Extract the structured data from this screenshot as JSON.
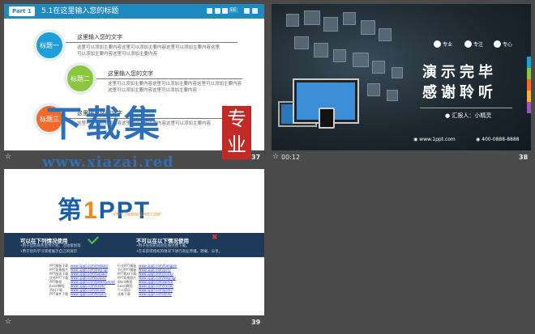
{
  "slides": [
    {
      "number": "37",
      "badge": "Part 1",
      "title": "5.1在这里输入您的标题",
      "nav_label": "EE",
      "topics": [
        {
          "label": "标题一",
          "heading": "这里输入您的文字",
          "color": "#1e9fd8",
          "body": "这里可以添加主要内容这里可以添加主要内容这里可以添加主要内容这里可以添加主要内容这里可以添加主要内容"
        },
        {
          "label": "标题二",
          "heading": "这里输入您的文字",
          "color": "#8cc63f",
          "body": "这里可以添加主要内容这里可以添加主要内容这里可以添加主要内容这里可以添加主要内容这里可以添加主要内容"
        },
        {
          "label": "标题三",
          "heading": "这里输入您的文字",
          "color": "#f26b2b",
          "body": "这里可以添加主要内容这里可以添加主要内容这里可以添加主要内容"
        }
      ]
    },
    {
      "number": "38",
      "time": "00:12",
      "features": [
        "专业",
        "专注",
        "专心"
      ],
      "line1": "演示完毕",
      "line2": "感谢聆听",
      "reporter": "汇报人：小精灵",
      "website": "www.1ppt.com",
      "phone": "400-0888-8888",
      "accent_colors": [
        "#1e9fd8",
        "#8cc63f",
        "#f26b2b",
        "#f5b335",
        "#9b59b6"
      ]
    },
    {
      "number": "39",
      "logo_text": "第1PPT",
      "logo_prefix": "第",
      "logo_one": "1",
      "logo_suffix": "PPT",
      "logo_url": "HTTP://WWW.1PPT.COM",
      "can_heading": "可以在下列情况使用",
      "can_lines": [
        "•用于您的商务宣传介绍、活动策划等",
        "•用于您的学习或者展示自己的演示"
      ],
      "cannot_heading": "不可以在以下情况使用",
      "cannot_lines": [
        "•用于任何形式的在线付费下载。",
        "•在未获得授权的情况下进行商业传播、转载、分享。"
      ],
      "link_columns": [
        {
          "labels": [
            "PPT模板下载",
            "PPT背景图片",
            "PPT图表下载",
            "优秀PPT下载",
            "PPT教程",
            "Excel教程",
            "资料下载",
            "PPT课件下载"
          ],
          "links": [
            "www.1ppt.com/moban/",
            "www.1ppt.com/beijing/",
            "www.1ppt.com/tubiao/",
            "www.1ppt.com/xiazai/",
            "www.1ppt.com/powerpoint/",
            "www.1ppt.com/excel/",
            "www.1ppt.com/ziliao/",
            "www.1ppt.com/kejian/"
          ]
        },
        {
          "labels": [
            "行业PPT模板",
            "节日PPT模板",
            "PPT素材下载",
            "PPT背景图片",
            "Word教程",
            "Excel教程",
            "个人简历",
            "试卷下载"
          ],
          "links": [
            "www.1ppt.com/hangye/",
            "www.1ppt.com/jieri/",
            "www.1ppt.com/sucai/",
            "www.1ppt.com/beijing/",
            "www.1ppt.com/word/",
            "www.1ppt.com/excel/",
            "www.1ppt.com/jianli/",
            "www.1ppt.com/shiti/"
          ]
        }
      ]
    }
  ],
  "watermark": {
    "big": "下载集",
    "seal_top": "专",
    "seal_bottom": "业",
    "url": "www.xiazai.red"
  }
}
